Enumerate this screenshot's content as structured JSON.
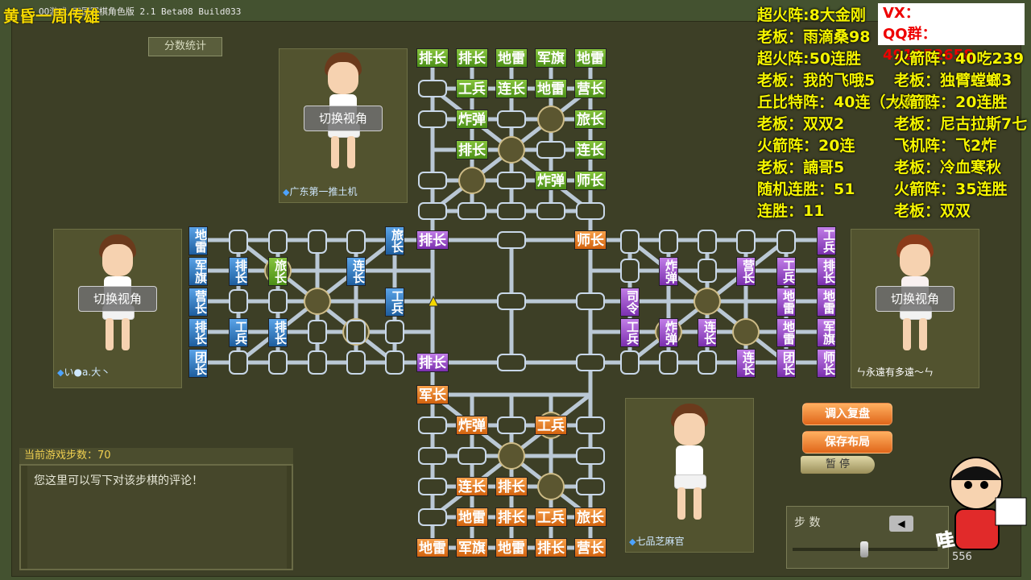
{
  "window": {
    "title": "QQ游戏 四国军棋角色版 2.1 Beta08 Build033",
    "streamer": "黄昏一周传雄"
  },
  "overlay": {
    "vx": "VX：douyu297535",
    "qq": "QQ群：491352658",
    "left_col": [
      "超火阵:8大金刚",
      "老板：雨滴桑98",
      "超火阵:50连胜",
      "老板：我的飞哦5",
      "丘比特阵：40连（大满贯）",
      "老板：双双2",
      "火箭阵：20连",
      "老板：諵哥5",
      "随机连胜：51",
      "连胜：11"
    ],
    "right_col": [
      "火箭阵：40吃239",
      "老板：独臂螳螂3",
      "火箭阵：20连胜",
      "老板：尼古拉斯7七",
      "飞机阵：飞2炸",
      "老板：冷血寒秋",
      "火箭阵：35连胜",
      "老板：双双"
    ]
  },
  "score_button": "分数统计",
  "players": {
    "top": {
      "view_button": "切换视角",
      "name": "广东第一推土机"
    },
    "left": {
      "view_button": "切换视角",
      "name": "い●a.大丶"
    },
    "right": {
      "view_button": "切换视角",
      "name": "ㄣ永遠有多遠～ㄣ"
    },
    "bottom": {
      "name": "七品芝麻官"
    }
  },
  "pieces": {
    "top": [
      "排长",
      "排长",
      "地雷",
      "军旗",
      "地雷",
      "工兵",
      "连长",
      "地雷",
      "营长",
      "炸弹",
      "旅长",
      "排长",
      "连长",
      "炸弹",
      "师长"
    ],
    "left": [
      "地雷",
      "军旗",
      "营长",
      "排长",
      "团长",
      "排长",
      "旅长",
      "连长",
      "工兵",
      "排长",
      "工兵",
      "旅长",
      "连长"
    ],
    "right": [
      "工兵",
      "排长",
      "地雷",
      "军旗",
      "师长",
      "炸弹",
      "营长",
      "工兵",
      "地雷",
      "司令",
      "工兵",
      "炸弹",
      "连长",
      "地雷",
      "连长",
      "团长"
    ],
    "bottom": [
      "军长",
      "炸弹",
      "工兵",
      "连长",
      "排长",
      "地雷",
      "排长",
      "工兵",
      "旅长",
      "地雷",
      "军旗",
      "地雷",
      "排长",
      "营长"
    ],
    "center": [
      "排长",
      "师长",
      "工兵",
      "排长"
    ]
  },
  "comment": {
    "steps_label": "当前游戏步数：70",
    "placeholder": "您这里可以写下对该步棋的评论！"
  },
  "controls": {
    "load_replay": "调入复盘",
    "save_layout": "保存布局",
    "pause": "暂 停",
    "steps": "步 数",
    "prev": "◀",
    "score_num": "556"
  },
  "colors": {
    "top": "#5da227",
    "left": "#2f74bb",
    "right": "#9745c9",
    "bottom": "#e47a26",
    "overlay_text": "#f5f500"
  }
}
